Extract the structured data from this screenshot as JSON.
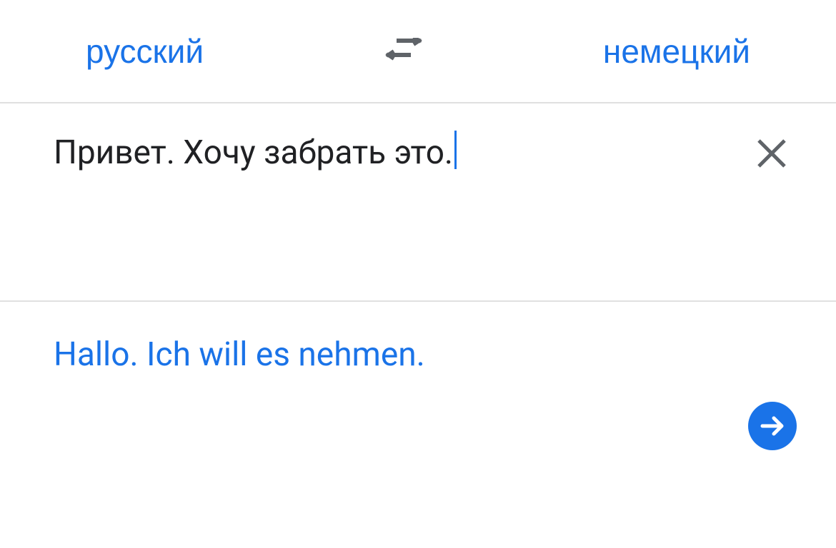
{
  "header": {
    "source_language": "русский",
    "target_language": "немецкий"
  },
  "input": {
    "text": "Привет. Хочу забрать это."
  },
  "output": {
    "text": "Hallo.  Ich will es nehmen."
  },
  "colors": {
    "accent": "#1a73e8",
    "text": "#202124",
    "icon_gray": "#5f6368",
    "border": "#e0e0e0"
  }
}
